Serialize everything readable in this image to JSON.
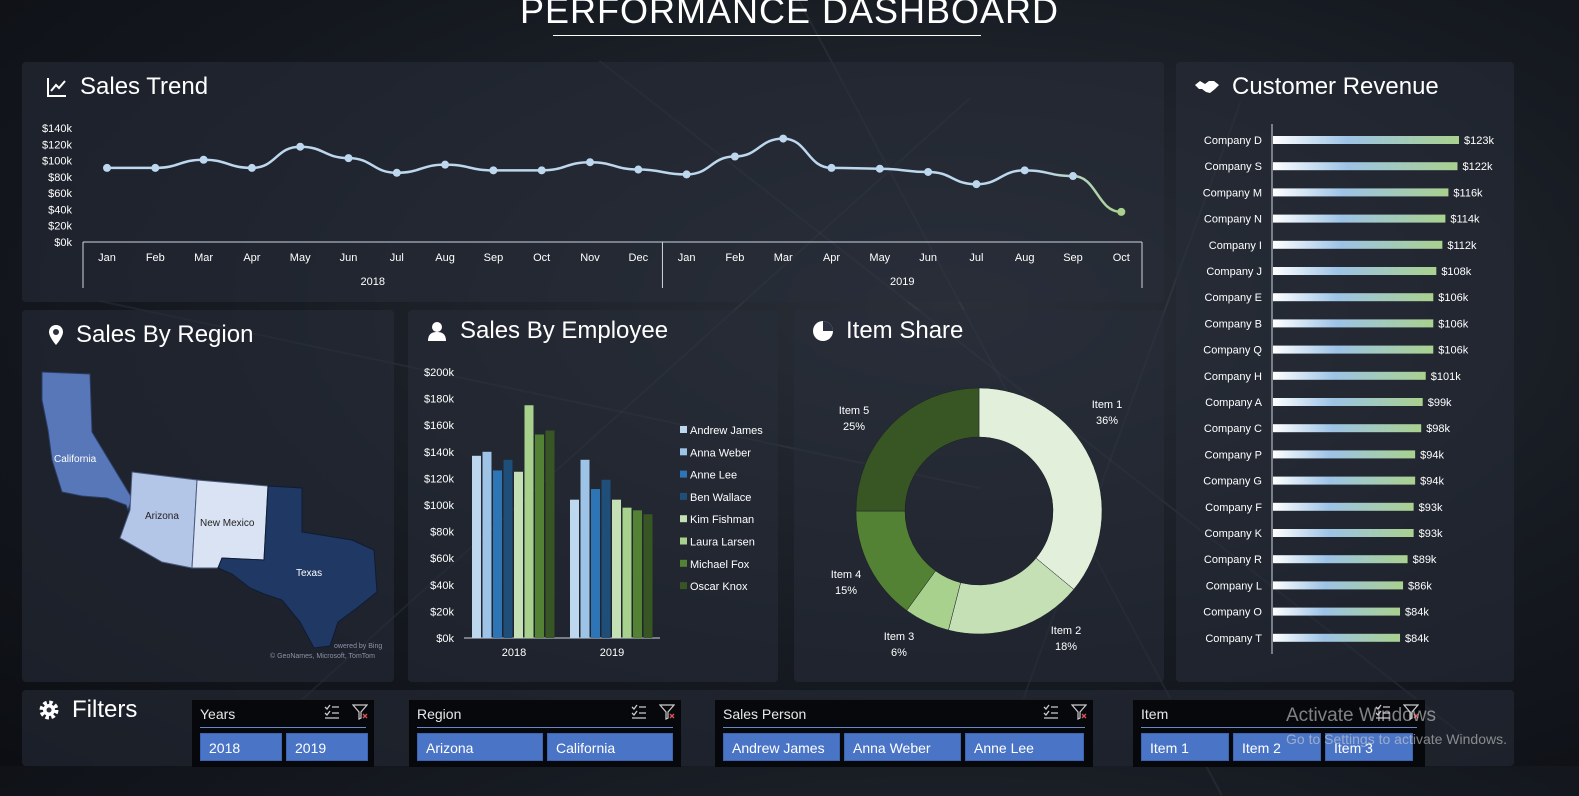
{
  "header": {
    "title": "PERFORMANCE DASHBOARD"
  },
  "panels": {
    "sales_trend": "Sales Trend",
    "customer_revenue": "Customer Revenue",
    "sales_by_region": "Sales By Region",
    "sales_by_employee": "Sales By Employee",
    "item_share": "Item Share",
    "filters": "Filters"
  },
  "map": {
    "states": [
      "California",
      "Arizona",
      "New Mexico",
      "Texas"
    ],
    "attribution_1": "owered by Bing",
    "attribution_2": "© GeoNames, Microsoft, TomTom"
  },
  "slicers": [
    {
      "title": "Years",
      "items": [
        "2018",
        "2019"
      ]
    },
    {
      "title": "Region",
      "items": [
        "Arizona",
        "California"
      ]
    },
    {
      "title": "Sales Person",
      "items": [
        "Andrew James",
        "Anna Weber",
        "Anne Lee"
      ]
    },
    {
      "title": "Item",
      "items": [
        "Item 1",
        "Item 2",
        "Item 3"
      ]
    }
  ],
  "watermark": {
    "line1": "Activate Windows",
    "line2": "Go to Settings to activate Windows."
  },
  "colors": {
    "accent_blue": "#4a74c6",
    "line": "#b9d3ee",
    "green_dark": "#375623",
    "green_light": "#e2efda"
  },
  "chart_data": [
    {
      "type": "line",
      "title": "Sales Trend",
      "y_ticks": [
        "$0k",
        "$20k",
        "$40k",
        "$60k",
        "$80k",
        "$100k",
        "$120k",
        "$140k"
      ],
      "ylim": [
        0,
        140000
      ],
      "months": [
        "Jan",
        "Feb",
        "Mar",
        "Apr",
        "May",
        "Jun",
        "Jul",
        "Aug",
        "Sep",
        "Oct",
        "Nov",
        "Dec",
        "Jan",
        "Feb",
        "Mar",
        "Apr",
        "May",
        "Jun",
        "Jul",
        "Aug",
        "Sep",
        "Oct"
      ],
      "years": [
        "2018",
        "2019"
      ],
      "values": [
        91000,
        91000,
        101000,
        91000,
        117000,
        103000,
        85000,
        95000,
        88000,
        88000,
        98000,
        89000,
        83000,
        105000,
        127000,
        91000,
        90000,
        86000,
        71000,
        88000,
        81000,
        37000
      ],
      "grid": false
    },
    {
      "type": "bar",
      "title": "Customer Revenue",
      "orientation": "horizontal",
      "categories": [
        "Company D",
        "Company S",
        "Company M",
        "Company N",
        "Company I",
        "Company J",
        "Company E",
        "Company B",
        "Company Q",
        "Company H",
        "Company A",
        "Company C",
        "Company P",
        "Company G",
        "Company F",
        "Company K",
        "Company R",
        "Company L",
        "Company O",
        "Company T"
      ],
      "values": [
        123,
        122,
        116,
        114,
        112,
        108,
        106,
        106,
        106,
        101,
        99,
        98,
        94,
        94,
        93,
        93,
        89,
        86,
        84,
        84
      ],
      "labels": [
        "$123k",
        "$122k",
        "$116k",
        "$114k",
        "$112k",
        "$108k",
        "$106k",
        "$106k",
        "$106k",
        "$101k",
        "$99k",
        "$98k",
        "$94k",
        "$94k",
        "$93k",
        "$93k",
        "$89k",
        "$86k",
        "$84k",
        "$84k"
      ]
    },
    {
      "type": "bar",
      "title": "Sales By Employee",
      "categories": [
        "2018",
        "2019"
      ],
      "y_ticks": [
        "$0k",
        "$20k",
        "$40k",
        "$60k",
        "$80k",
        "$100k",
        "$120k",
        "$140k",
        "$160k",
        "$180k",
        "$200k"
      ],
      "ylim": [
        0,
        200000
      ],
      "legend": "right",
      "series": [
        {
          "name": "Andrew James",
          "color": "#bdd7ee",
          "values": [
            137000,
            104000
          ]
        },
        {
          "name": "Anna Weber",
          "color": "#9dc3e6",
          "values": [
            140000,
            134000
          ]
        },
        {
          "name": "Anne Lee",
          "color": "#2e75b6",
          "values": [
            126000,
            112000
          ]
        },
        {
          "name": "Ben Wallace",
          "color": "#1f4e79",
          "values": [
            134000,
            119000
          ]
        },
        {
          "name": "Kim Fishman",
          "color": "#c5e0b4",
          "values": [
            125000,
            104000
          ]
        },
        {
          "name": "Laura Larsen",
          "color": "#a9d18e",
          "values": [
            175000,
            98000
          ]
        },
        {
          "name": "Michael Fox",
          "color": "#548235",
          "values": [
            153000,
            96000
          ]
        },
        {
          "name": "Oscar Knox",
          "color": "#375623",
          "values": [
            156000,
            93000
          ]
        }
      ]
    },
    {
      "type": "pie",
      "title": "Item Share",
      "donut": true,
      "slices": [
        {
          "label": "Item 1",
          "pct": "36%",
          "value": 36,
          "color": "#e2efda"
        },
        {
          "label": "Item 2",
          "pct": "18%",
          "value": 18,
          "color": "#c5e0b4"
        },
        {
          "label": "Item 3",
          "pct": "6%",
          "value": 6,
          "color": "#a9d18e"
        },
        {
          "label": "Item 4",
          "pct": "15%",
          "value": 15,
          "color": "#548235"
        },
        {
          "label": "Item 5",
          "pct": "25%",
          "value": 25,
          "color": "#375623"
        }
      ]
    }
  ]
}
